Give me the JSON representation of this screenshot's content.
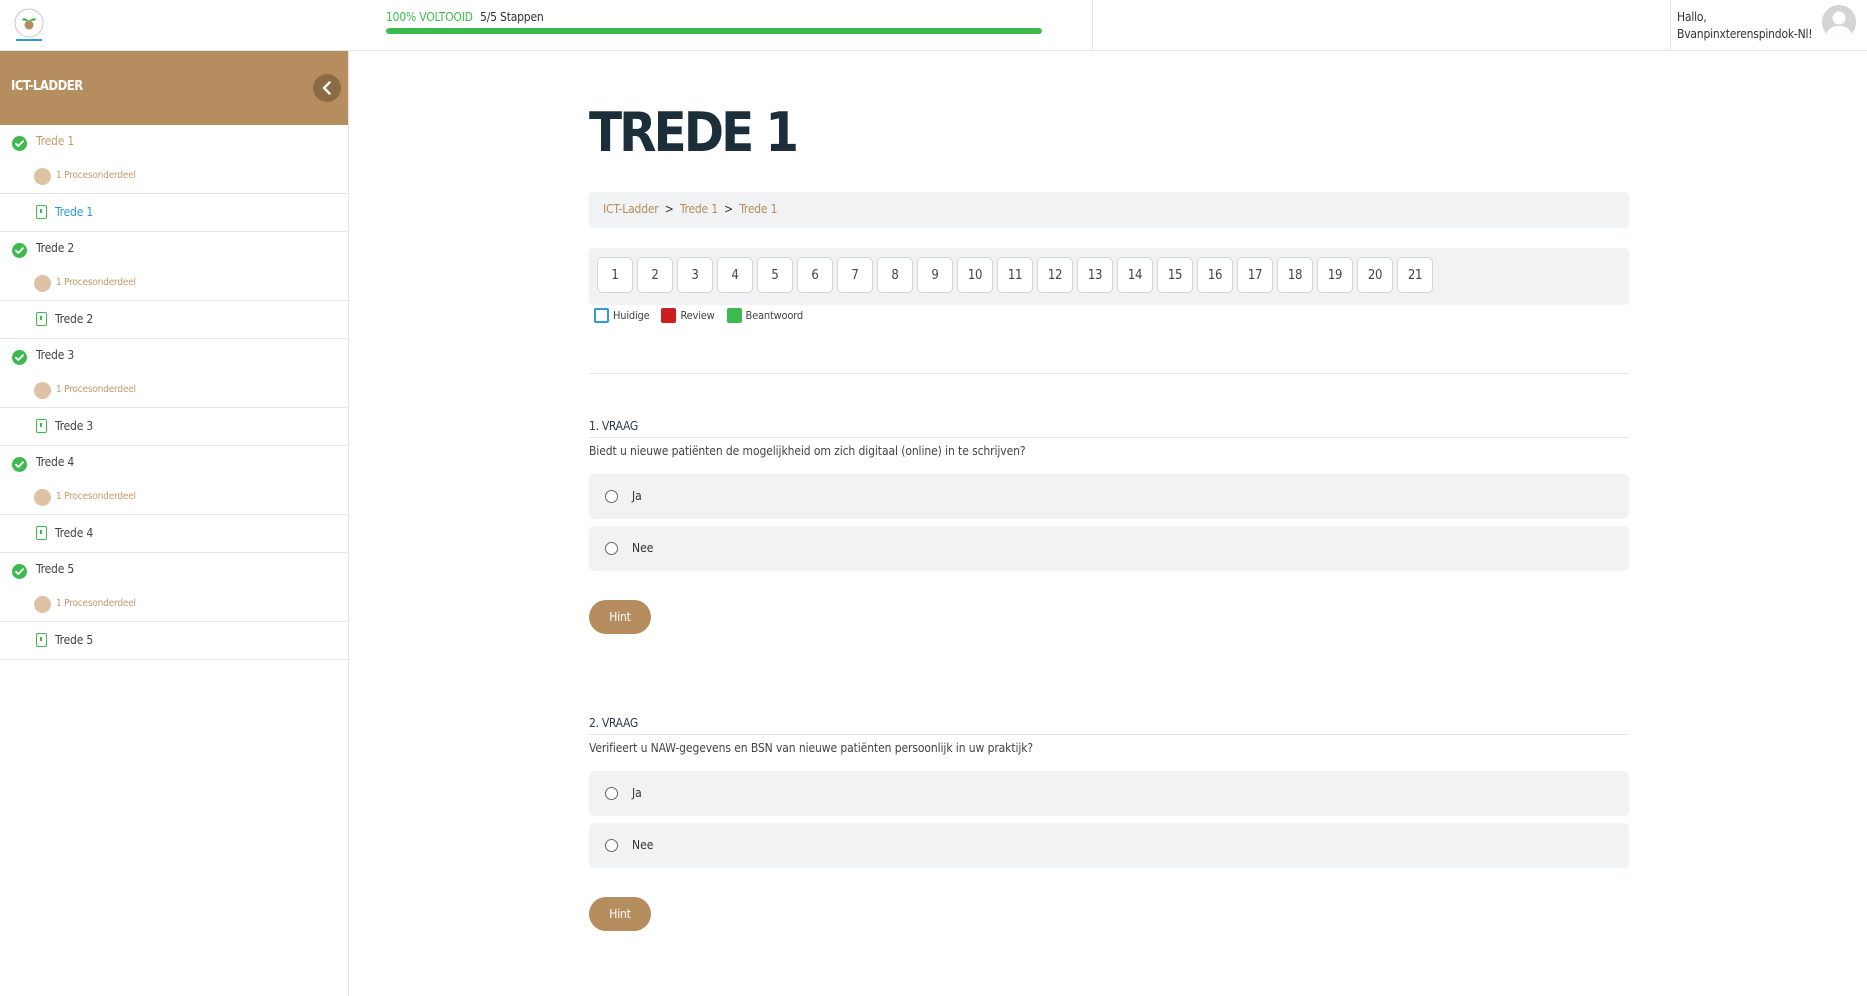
{
  "header": {
    "progress_percent_label": "100% VOLTOOID",
    "progress_steps_label": "5/5 Stappen",
    "progress_value": 100,
    "greeting_line1": "Hallo,",
    "greeting_line2": "Bvanpinxterenspindok-Nl!"
  },
  "sidebar": {
    "title": "ICT-LADDER",
    "groups": [
      {
        "step": "Trede 1",
        "sub": "1 Procesonderdeel",
        "item": "Trede 1"
      },
      {
        "step": "Trede 2",
        "sub": "1 Procesonderdeel",
        "item": "Trede 2"
      },
      {
        "step": "Trede 3",
        "sub": "1 Procesonderdeel",
        "item": "Trede 3"
      },
      {
        "step": "Trede 4",
        "sub": "1 Procesonderdeel",
        "item": "Trede 4"
      },
      {
        "step": "Trede 5",
        "sub": "1 Procesonderdeel",
        "item": "Trede 5"
      }
    ]
  },
  "main": {
    "title": "TREDE 1",
    "breadcrumb": [
      "ICT-Ladder",
      "Trede 1",
      "Trede 1"
    ],
    "breadcrumb_sep": ">",
    "pages": [
      "1",
      "2",
      "3",
      "4",
      "5",
      "6",
      "7",
      "8",
      "9",
      "10",
      "11",
      "12",
      "13",
      "14",
      "15",
      "16",
      "17",
      "18",
      "19",
      "20",
      "21"
    ],
    "legend": [
      {
        "label": "Huidige",
        "color": "#2c9bd6"
      },
      {
        "label": "Review",
        "color": "#cc1e1e"
      },
      {
        "label": "Beantwoord",
        "color": "#3dba4e"
      }
    ],
    "questions": [
      {
        "label": "1. VRAAG",
        "text": "Biedt u nieuwe patiënten de mogelijkheid om zich digitaal (online) in te schrijven?",
        "options": [
          "Ja",
          "Nee"
        ],
        "hint": "Hint"
      },
      {
        "label": "2. VRAAG",
        "text": "Verifieert u NAW-gegevens en BSN van nieuwe patiënten persoonlijk in uw praktijk?",
        "options": [
          "Ja",
          "Nee"
        ],
        "hint": "Hint"
      }
    ]
  },
  "colors": {
    "accent": "#b58d5e",
    "success": "#3dba4e",
    "link_active": "#2c9bd6"
  }
}
